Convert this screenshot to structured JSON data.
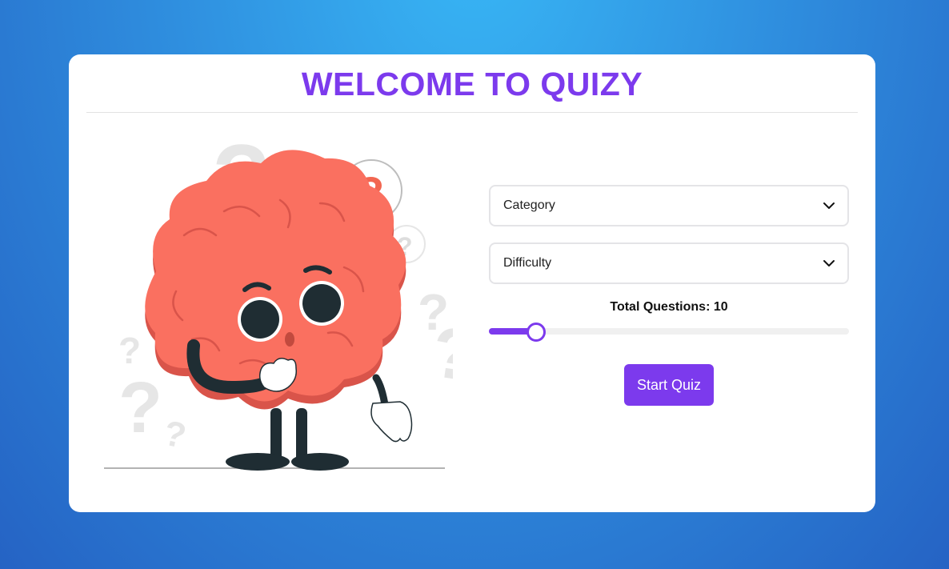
{
  "header": {
    "title": "WELCOME TO QUIZY"
  },
  "form": {
    "category": {
      "selected": "Category"
    },
    "difficulty": {
      "selected": "Difficulty"
    },
    "questions": {
      "label": "Total Questions: 10",
      "value": 10,
      "slider_fraction": 0.13
    },
    "start_label": "Start Quiz"
  },
  "colors": {
    "accent": "#7c3aed",
    "brain": "#fa7060",
    "brain_shadow": "#d9544a",
    "outline": "#1f2d33",
    "question_mark": "#e5e5e5",
    "question_mark_red": "#f26650"
  },
  "icons": {
    "select_chevron": "chevron-down-icon"
  }
}
